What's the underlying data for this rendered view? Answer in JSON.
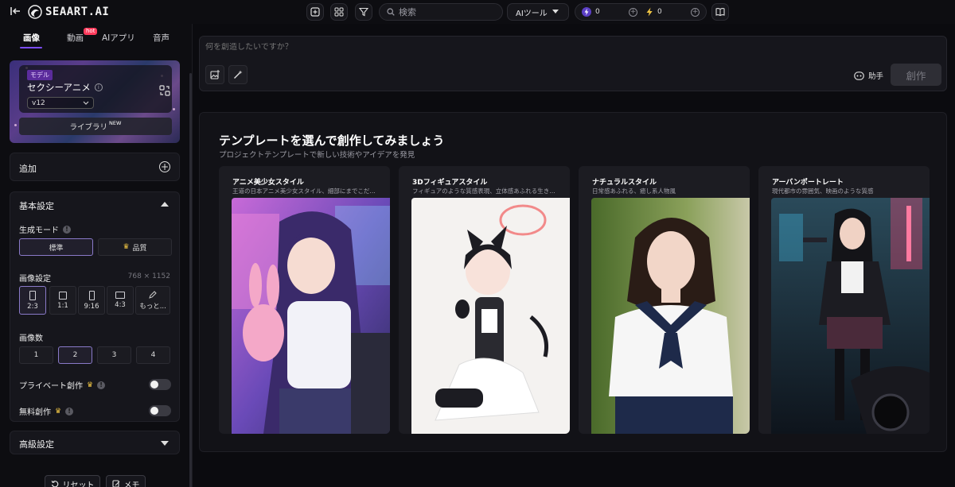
{
  "topbar": {
    "logo_text": "SEAART.AI",
    "search_placeholder": "検索",
    "ai_tools_label": "AIツール",
    "credits": [
      {
        "icon": "lightning-purple-icon",
        "value": "0"
      },
      {
        "icon": "lightning-yellow-icon",
        "value": "0"
      }
    ]
  },
  "left": {
    "tabs": [
      {
        "label": "画像",
        "active": true
      },
      {
        "label": "動画",
        "badge": "hot"
      },
      {
        "label": "AIアプリ"
      },
      {
        "label": "音声"
      }
    ],
    "model": {
      "tag": "モデル",
      "name": "セクシーアニメ",
      "version": "v12",
      "library_label": "ライブラリ",
      "library_badge": "NEW"
    },
    "add_label": "追加",
    "basic_settings": {
      "title": "基本設定",
      "mode_label": "生成モード",
      "modes": [
        "標準",
        "品質"
      ],
      "selected_mode": "標準",
      "image_settings_label": "画像設定",
      "size_readout": "768 × 1152",
      "ratios": [
        "2:3",
        "1:1",
        "9:16",
        "4:3",
        "もっと..."
      ],
      "selected_ratio": "2:3",
      "count_label": "画像数",
      "counts": [
        "1",
        "2",
        "3",
        "4"
      ],
      "selected_count": "2",
      "private_label": "プライベート創作",
      "free_label": "無料創作",
      "private_on": false,
      "free_on": false
    },
    "advanced_label": "高級設定",
    "reset_label": "リセット",
    "memo_label": "メモ"
  },
  "prompt": {
    "placeholder": "何を創造したいですか？",
    "assist_label": "助手",
    "create_label": "創作"
  },
  "templates": {
    "title": "テンプレートを選んで創作してみましょう",
    "subtitle": "プロジェクトテンプレートで新しい技術やアイデアを発見",
    "cards": [
      {
        "title": "アニメ美少女スタイル",
        "desc": "王道の日本アニメ美少女スタイル、細部にまでこだ…"
      },
      {
        "title": "3Dフィギュアスタイル",
        "desc": "フィギュアのような質感表現、立体感あふれる生き…"
      },
      {
        "title": "ナチュラルスタイル",
        "desc": "日常感あふれる、癒し系人物風"
      },
      {
        "title": "アーバンポートレート",
        "desc": "現代都市の雰囲気、映画のような質感"
      }
    ]
  },
  "colors": {
    "accent": "#7c4dff",
    "hot": "#ff3b5c",
    "crown": "#f2c744"
  }
}
